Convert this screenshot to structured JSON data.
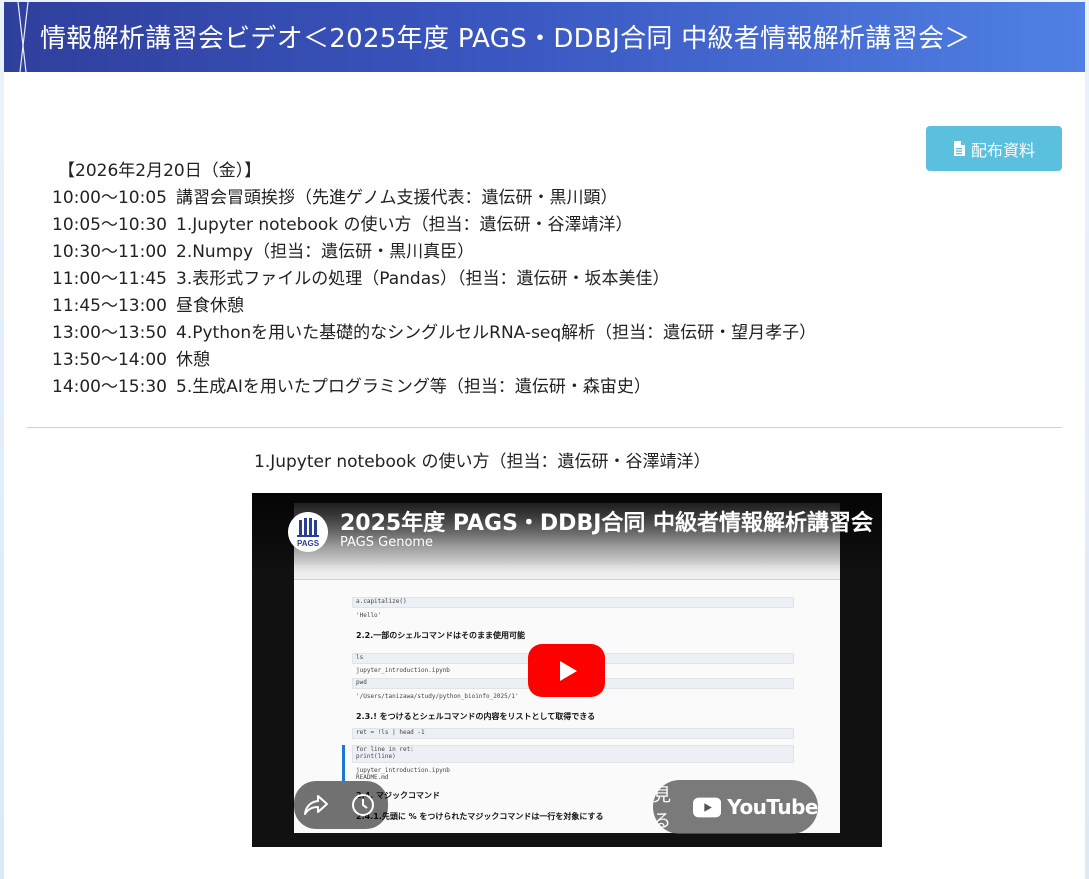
{
  "header": {
    "title": "情報解析講習会ビデオ＜2025年度 PAGS・DDBJ合同 中級者情報解析講習会＞"
  },
  "handout_button": {
    "label": "配布資料",
    "icon": "file-text-icon"
  },
  "schedule": {
    "date": "【2026年2月20日（金）】",
    "rows": [
      {
        "time": "10:00～10:05",
        "item": "講習会冒頭挨拶（先進ゲノム支援代表：遺伝研・黒川顕）"
      },
      {
        "time": "10:05～10:30",
        "item": "1.Jupyter notebook の使い方（担当：遺伝研・谷澤靖洋）"
      },
      {
        "time": "10:30～11:00",
        "item": "2.Numpy（担当：遺伝研・黒川真臣）"
      },
      {
        "time": "11:00～11:45",
        "item": "3.表形式ファイルの処理（Pandas）（担当：遺伝研・坂本美佳）"
      },
      {
        "time": "11:45～13:00",
        "item": "昼食休憩"
      },
      {
        "time": "13:00～13:50",
        "item": "4.Pythonを用いた基礎的なシングルセルRNA-seq解析（担当：遺伝研・望月孝子）"
      },
      {
        "time": "13:50～14:00",
        "item": "休憩"
      },
      {
        "time": "14:00～15:30",
        "item": "5.生成AIを用いたプログラミング等（担当：遺伝研・森宙史）"
      }
    ]
  },
  "video_section": {
    "heading": "1.Jupyter notebook の使い方（担当：遺伝研・谷澤靖洋）",
    "player": {
      "title": "2025年度 PAGS・DDBJ合同 中級者情報解析講習会",
      "channel": "PAGS Genome",
      "avatar_text": "PAGS",
      "watch_label": "見る",
      "youtube_word": "YouTube",
      "icons": {
        "play": "play-icon",
        "share": "share-icon",
        "watch_later": "clock-icon",
        "youtube": "youtube-logo-icon"
      },
      "screen": {
        "headings": [
          "2.2.一部のシェルコマンドはそのまま使用可能",
          "2.3.! をつけるとシェルコマンドの内容をリストとして取得できる",
          "2.4. マジックコマンド",
          "2.4.1.先頭に % をつけられたマジックコマンドは一行を対象にする"
        ],
        "code": [
          "a.capitalize()",
          "'Hello'",
          "ls",
          "jupyter_introduction.ipynb",
          "README.md",
          "pwd",
          "'/Users/tanizawa/study/python_bioinfo_2025/1'",
          "ret = !ls | head -1",
          "for line in ret:",
          "    print(line)",
          "jupyter_introduction.ipynb",
          "README.md"
        ]
      }
    }
  },
  "colors": {
    "header_gradient_start": "#2f3f9c",
    "header_gradient_end": "#5080e4",
    "handout_button": "#5bc0de",
    "youtube_red": "#ff0000"
  }
}
